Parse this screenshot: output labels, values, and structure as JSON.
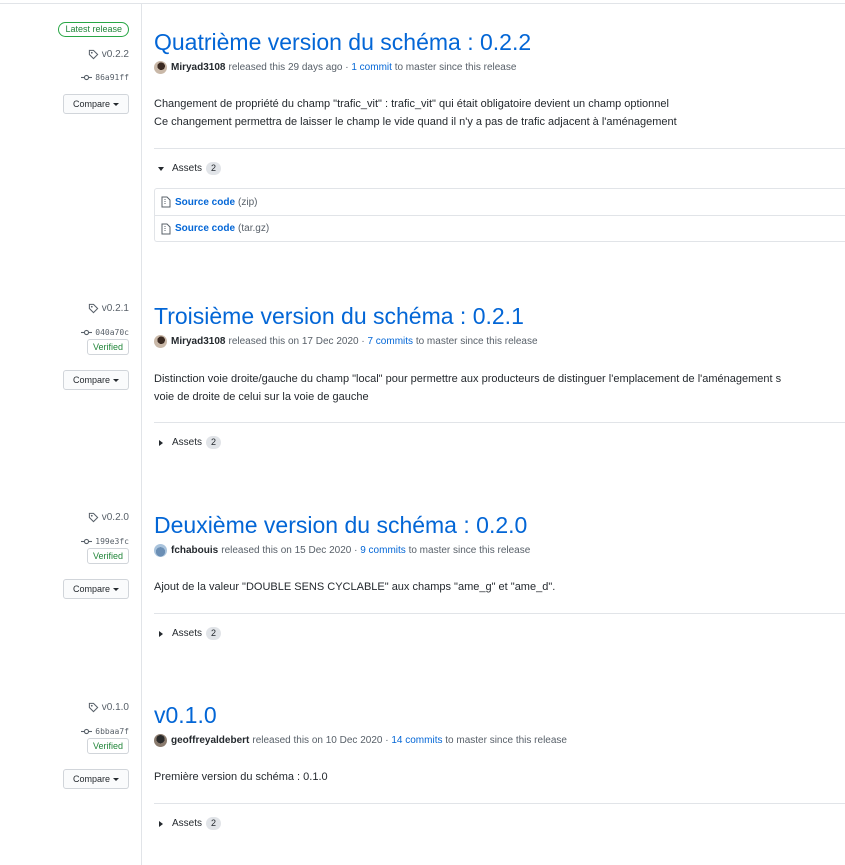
{
  "colors": {
    "link": "#0366d6",
    "green": "#22863a",
    "border": "#e1e4e8"
  },
  "releases": [
    {
      "latest_label": "Latest release",
      "tag": "v0.2.2",
      "commit": "86a91ff",
      "compare_label": "Compare",
      "title": "Quatrième version du schéma : 0.2.2",
      "author": "Miryad3108",
      "released_text": "released this 29 days ago ·",
      "commits_link": "1 commit",
      "since_text": "to master since this release",
      "description": [
        "Changement de propriété du champ \"trafic_vit\" : trafic_vit\" qui était obligatoire devient un champ optionnel",
        "Ce changement permettra de laisser le champ le vide quand il n'y a pas de trafic adjacent à l'aménagement"
      ],
      "assets_label": "Assets",
      "assets_count": "2",
      "assets": [
        {
          "name": "Source code",
          "ext": "(zip)"
        },
        {
          "name": "Source code",
          "ext": "(tar.gz)"
        }
      ]
    },
    {
      "tag": "v0.2.1",
      "commit": "040a70c",
      "verified_label": "Verified",
      "compare_label": "Compare",
      "title": "Troisième version du schéma : 0.2.1",
      "author": "Miryad3108",
      "released_text": "released this on 17 Dec 2020 ·",
      "commits_link": "7 commits",
      "since_text": "to master since this release",
      "description": [
        "Distinction voie droite/gauche du champ \"local\" pour permettre aux producteurs de distinguer l'emplacement de l'aménagement s",
        "voie de droite de celui sur la voie de gauche"
      ],
      "assets_label": "Assets",
      "assets_count": "2"
    },
    {
      "tag": "v0.2.0",
      "commit": "199e3fc",
      "verified_label": "Verified",
      "compare_label": "Compare",
      "title": "Deuxième version du schéma : 0.2.0",
      "author": "fchabouis",
      "released_text": "released this on 15 Dec 2020 ·",
      "commits_link": "9 commits",
      "since_text": "to master since this release",
      "description": [
        "Ajout de la valeur \"DOUBLE SENS CYCLABLE\" aux champs \"ame_g\" et \"ame_d\"."
      ],
      "assets_label": "Assets",
      "assets_count": "2"
    },
    {
      "tag": "v0.1.0",
      "commit": "6bbaa7f",
      "verified_label": "Verified",
      "compare_label": "Compare",
      "title": "v0.1.0",
      "author": "geoffreyaldebert",
      "released_text": "released this on 10 Dec 2020 ·",
      "commits_link": "14 commits",
      "since_text": "to master since this release",
      "description": [
        "Première version du schéma : 0.1.0"
      ],
      "assets_label": "Assets",
      "assets_count": "2"
    }
  ]
}
